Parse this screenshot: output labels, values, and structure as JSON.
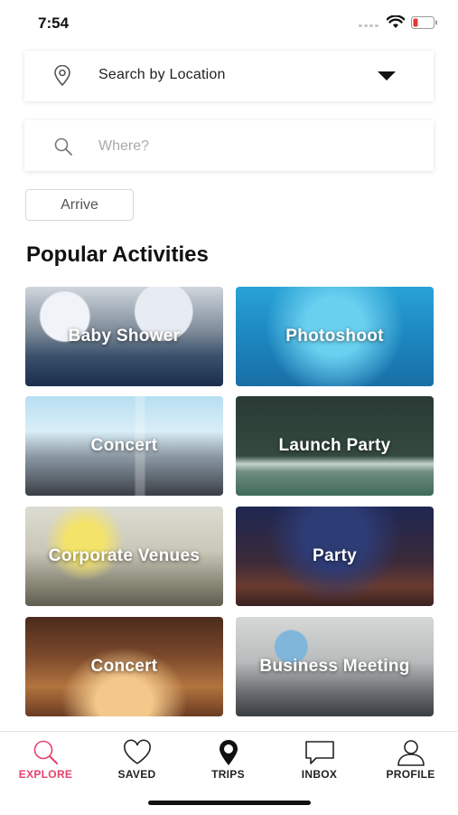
{
  "status": {
    "time": "7:54"
  },
  "location_select": {
    "label": "Search by Location",
    "icon": "map-pin-icon"
  },
  "search": {
    "placeholder": "Where?",
    "value": ""
  },
  "arrive": {
    "label": "Arrive"
  },
  "section": {
    "title": "Popular Activities"
  },
  "activities": [
    {
      "label": "Baby Shower"
    },
    {
      "label": "Photoshoot"
    },
    {
      "label": "Concert"
    },
    {
      "label": "Launch Party"
    },
    {
      "label": "Corporate Venues"
    },
    {
      "label": "Party"
    },
    {
      "label": "Concert"
    },
    {
      "label": "Business Meeting"
    }
  ],
  "tabs": [
    {
      "label": "EXPLORE",
      "icon": "search-icon"
    },
    {
      "label": "SAVED",
      "icon": "heart-icon"
    },
    {
      "label": "TRIPS",
      "icon": "map-pin-icon"
    },
    {
      "label": "INBOX",
      "icon": "chat-bubble-icon"
    },
    {
      "label": "PROFILE",
      "icon": "person-icon"
    }
  ],
  "colors": {
    "accent": "#e8416c",
    "text": "#222222",
    "placeholder": "#aaaaaa"
  }
}
